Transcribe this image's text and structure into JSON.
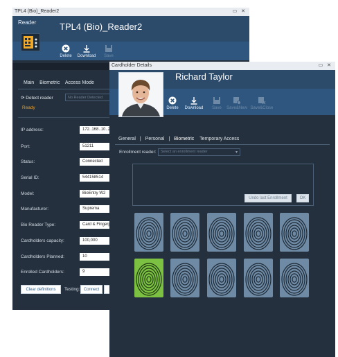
{
  "reader_window": {
    "title": "TPL4 (Bio)_Reader2",
    "header_label": "Reader",
    "header_title": "TPL4 (Bio)_Reader2",
    "toolbar": {
      "delete_label": "Delete",
      "download_label": "Download",
      "save_label": "Save"
    },
    "tabs": [
      "Main",
      "Biometric",
      "Access Mode"
    ],
    "detect_label": "Detect reader",
    "detect_placeholder": "No Reader Detected",
    "status_text": "Ready",
    "fields": [
      {
        "label": "IP address:",
        "value": "172..168..10..220"
      },
      {
        "label": "Port:",
        "value": "51211"
      },
      {
        "label": "Status:",
        "value": "Connected"
      },
      {
        "label": "Serial ID:",
        "value": "544158514"
      },
      {
        "label": "Model:",
        "value": "BioEntry W2"
      },
      {
        "label": "Manufacturer:",
        "value": "Suprema"
      },
      {
        "label": "Bio Reader Type:",
        "value": "Card & Fingerprint"
      },
      {
        "label": "Cardholders capacity:",
        "value": "100,000"
      },
      {
        "label": "Cardholders Planned:",
        "value": "10"
      },
      {
        "label": "Enrolled Cardholders:",
        "value": "9"
      }
    ],
    "clear_button": "Clear definitions",
    "testing_label": "Testing:",
    "connect_button": "Connect"
  },
  "cardholder_window": {
    "title": "Cardholder Details",
    "name": "Richard Taylor",
    "toolbar": {
      "delete_label": "Delete",
      "download_label": "Download",
      "save_label": "Save",
      "save_new_label": "Save&New",
      "save_close_label": "Save&Close"
    },
    "tabs": [
      "General",
      "Personal",
      "Biometric",
      "Temporary Access"
    ],
    "enrollment_label": "Enrollment reader:",
    "enrollment_placeholder": "Select an enrollment reader",
    "undo_button": "Undo last Enrollment",
    "ok_button": "OK",
    "fingerprints": [
      {
        "enrolled": false
      },
      {
        "enrolled": false
      },
      {
        "enrolled": false
      },
      {
        "enrolled": false
      },
      {
        "enrolled": false
      },
      {
        "enrolled": true
      },
      {
        "enrolled": false
      },
      {
        "enrolled": false
      },
      {
        "enrolled": false
      },
      {
        "enrolled": false
      }
    ]
  },
  "colors": {
    "window_bg": "#24303d",
    "header_bg": "#2c4a6a",
    "toolbar_bg": "#2e567f",
    "status_ready": "#e0a23a",
    "enrolled_green": "#7cc142",
    "finger_slot": "#6e8aa4"
  },
  "icons": [
    "reader-logo-icon",
    "delete-icon",
    "download-icon",
    "save-icon",
    "save-new-icon",
    "save-close-icon",
    "refresh-icon",
    "chevron-down-icon",
    "fingerprint-icon"
  ]
}
